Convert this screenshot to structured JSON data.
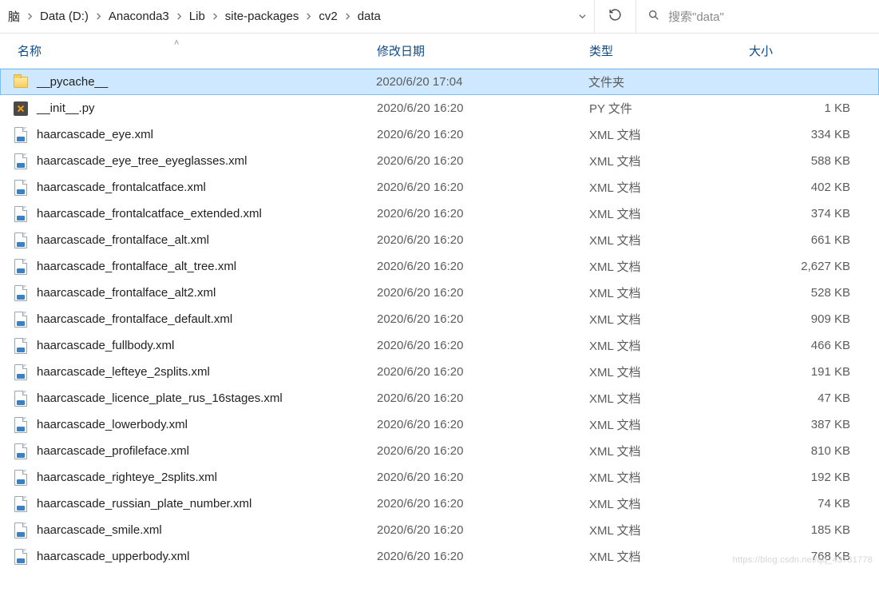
{
  "breadcrumb": {
    "items": [
      "脑",
      "Data (D:)",
      "Anaconda3",
      "Lib",
      "site-packages",
      "cv2",
      "data"
    ]
  },
  "search": {
    "placeholder": "搜索\"data\""
  },
  "columns": {
    "name": "名称",
    "date": "修改日期",
    "type": "类型",
    "size": "大小"
  },
  "files": [
    {
      "icon": "folder",
      "name": "__pycache__",
      "date": "2020/6/20 17:04",
      "type": "文件夹",
      "size": "",
      "selected": true
    },
    {
      "icon": "py",
      "name": "__init__.py",
      "date": "2020/6/20 16:20",
      "type": "PY 文件",
      "size": "1 KB"
    },
    {
      "icon": "xml",
      "name": "haarcascade_eye.xml",
      "date": "2020/6/20 16:20",
      "type": "XML 文档",
      "size": "334 KB"
    },
    {
      "icon": "xml",
      "name": "haarcascade_eye_tree_eyeglasses.xml",
      "date": "2020/6/20 16:20",
      "type": "XML 文档",
      "size": "588 KB"
    },
    {
      "icon": "xml",
      "name": "haarcascade_frontalcatface.xml",
      "date": "2020/6/20 16:20",
      "type": "XML 文档",
      "size": "402 KB"
    },
    {
      "icon": "xml",
      "name": "haarcascade_frontalcatface_extended.xml",
      "date": "2020/6/20 16:20",
      "type": "XML 文档",
      "size": "374 KB"
    },
    {
      "icon": "xml",
      "name": "haarcascade_frontalface_alt.xml",
      "date": "2020/6/20 16:20",
      "type": "XML 文档",
      "size": "661 KB"
    },
    {
      "icon": "xml",
      "name": "haarcascade_frontalface_alt_tree.xml",
      "date": "2020/6/20 16:20",
      "type": "XML 文档",
      "size": "2,627 KB"
    },
    {
      "icon": "xml",
      "name": "haarcascade_frontalface_alt2.xml",
      "date": "2020/6/20 16:20",
      "type": "XML 文档",
      "size": "528 KB"
    },
    {
      "icon": "xml",
      "name": "haarcascade_frontalface_default.xml",
      "date": "2020/6/20 16:20",
      "type": "XML 文档",
      "size": "909 KB"
    },
    {
      "icon": "xml",
      "name": "haarcascade_fullbody.xml",
      "date": "2020/6/20 16:20",
      "type": "XML 文档",
      "size": "466 KB"
    },
    {
      "icon": "xml",
      "name": "haarcascade_lefteye_2splits.xml",
      "date": "2020/6/20 16:20",
      "type": "XML 文档",
      "size": "191 KB"
    },
    {
      "icon": "xml",
      "name": "haarcascade_licence_plate_rus_16stages.xml",
      "date": "2020/6/20 16:20",
      "type": "XML 文档",
      "size": "47 KB"
    },
    {
      "icon": "xml",
      "name": "haarcascade_lowerbody.xml",
      "date": "2020/6/20 16:20",
      "type": "XML 文档",
      "size": "387 KB"
    },
    {
      "icon": "xml",
      "name": "haarcascade_profileface.xml",
      "date": "2020/6/20 16:20",
      "type": "XML 文档",
      "size": "810 KB"
    },
    {
      "icon": "xml",
      "name": "haarcascade_righteye_2splits.xml",
      "date": "2020/6/20 16:20",
      "type": "XML 文档",
      "size": "192 KB"
    },
    {
      "icon": "xml",
      "name": "haarcascade_russian_plate_number.xml",
      "date": "2020/6/20 16:20",
      "type": "XML 文档",
      "size": "74 KB"
    },
    {
      "icon": "xml",
      "name": "haarcascade_smile.xml",
      "date": "2020/6/20 16:20",
      "type": "XML 文档",
      "size": "185 KB"
    },
    {
      "icon": "xml",
      "name": "haarcascade_upperbody.xml",
      "date": "2020/6/20 16:20",
      "type": "XML 文档",
      "size": "768 KB"
    }
  ],
  "watermark": "https://blog.csdn.net/qq_43731778"
}
